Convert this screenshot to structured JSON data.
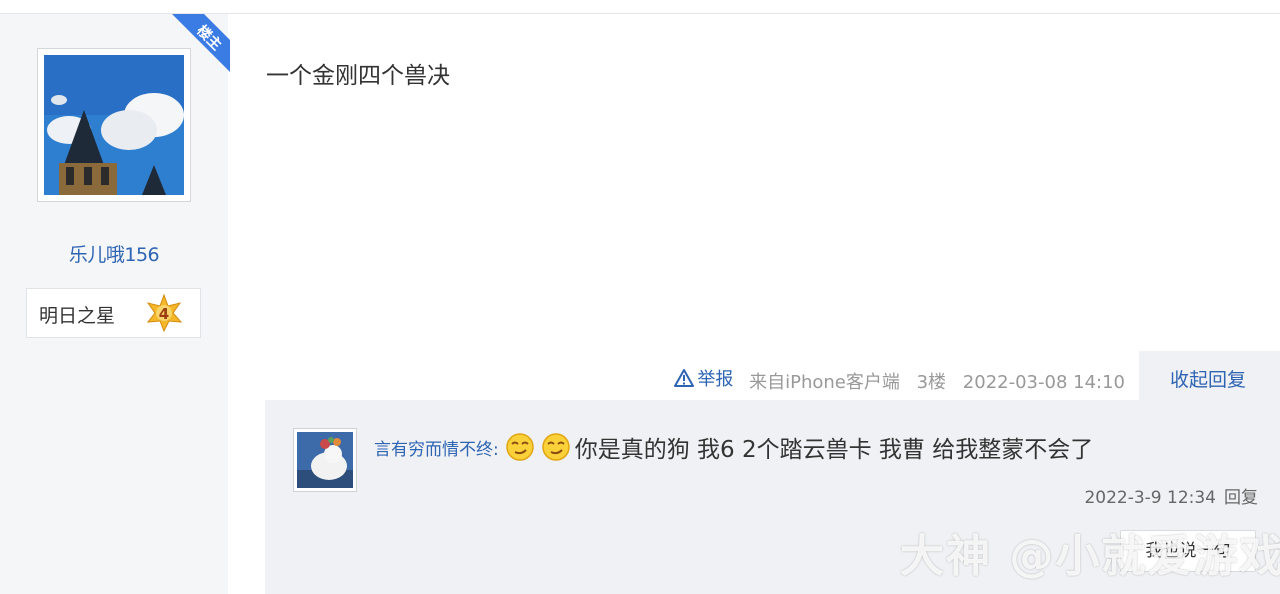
{
  "author": {
    "name": "乐儿哦156",
    "badge_label": "明日之星",
    "level": "4",
    "role_ribbon": "楼主"
  },
  "post": {
    "content": "一个金刚四个兽决",
    "report_label": "举报",
    "source": "来自iPhone客户端",
    "floor": "3楼",
    "time": "2022-03-08 14:10",
    "toggle_reply_label": "收起回复"
  },
  "reply": {
    "username": "言有穷而情不终:",
    "text": "你是真的狗 我6 2个踏云兽卡 我曹 给我整蒙不会了",
    "time": "2022-3-9 12:34",
    "reply_label": "回复"
  },
  "reply_button_label": "我也说一句",
  "watermark": "大神 @小就爱游戏",
  "colors": {
    "link": "#2d64b3",
    "ribbon": "#3b7be4",
    "sidebar_bg": "#f5f6f8",
    "reply_bg": "#f0f1f4"
  },
  "icons": {
    "report": "warning-triangle-icon",
    "level": "star-badge-icon",
    "emoji": "smirk-emoji-icon"
  }
}
